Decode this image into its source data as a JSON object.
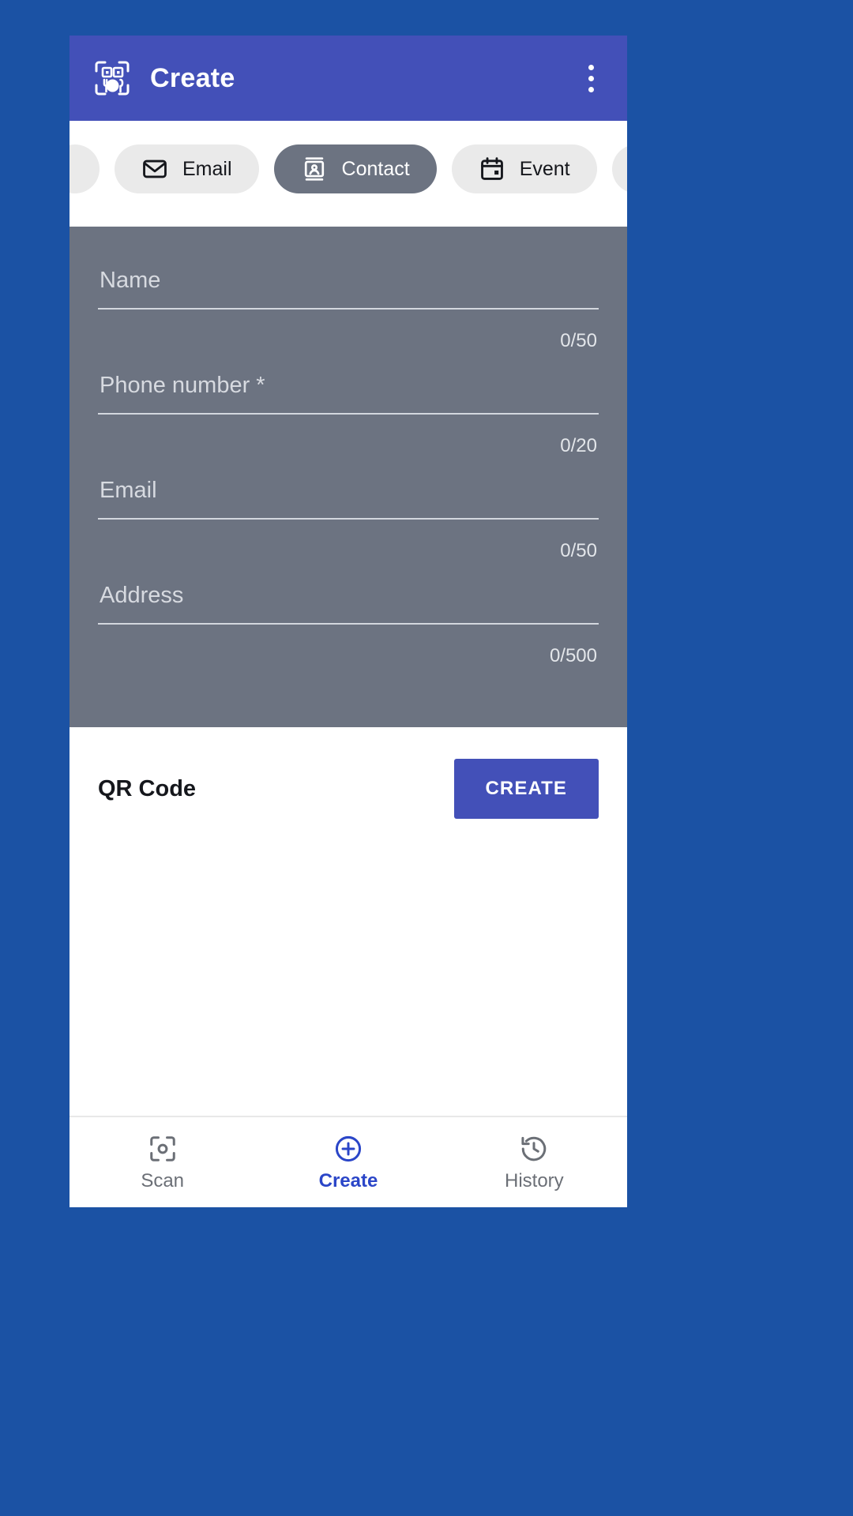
{
  "theme": {
    "outer_background": "#1b52a4",
    "appbar_color": "#4350b8",
    "accent": "#2b46c8",
    "scrim": "#6c7381",
    "chip_unselected_bg": "#eaeaea",
    "chip_selected_bg": "#6c7381",
    "create_button_bg": "#4350b8"
  },
  "appbar": {
    "title": "Create",
    "app_icon": "qr-food-scan-icon",
    "overflow_icon": "more-vertical-icon"
  },
  "chips": [
    {
      "label": "",
      "icon": "partial-chip-left",
      "selected": false,
      "partial": true
    },
    {
      "label": "Email",
      "icon": "mail-icon",
      "selected": false
    },
    {
      "label": "Contact",
      "icon": "contact-card-icon",
      "selected": true
    },
    {
      "label": "Event",
      "icon": "calendar-icon",
      "selected": false
    },
    {
      "label": "",
      "icon": "sms-icon",
      "selected": false,
      "partial": true
    }
  ],
  "form": {
    "fields": [
      {
        "label": "Name",
        "value": "",
        "counter": "0/50",
        "required": false
      },
      {
        "label": "Phone number *",
        "value": "",
        "counter": "0/20",
        "required": true
      },
      {
        "label": "Email",
        "value": "",
        "counter": "0/50",
        "required": false
      },
      {
        "label": "Address",
        "value": "",
        "counter": "0/500",
        "required": false
      }
    ]
  },
  "qr_section": {
    "title": "QR Code",
    "create_label": "CREATE"
  },
  "bottom_nav": {
    "items": [
      {
        "label": "Scan",
        "icon": "scan-frame-icon",
        "active": false
      },
      {
        "label": "Create",
        "icon": "plus-circle-icon",
        "active": true
      },
      {
        "label": "History",
        "icon": "history-clock-icon",
        "active": false
      }
    ]
  }
}
